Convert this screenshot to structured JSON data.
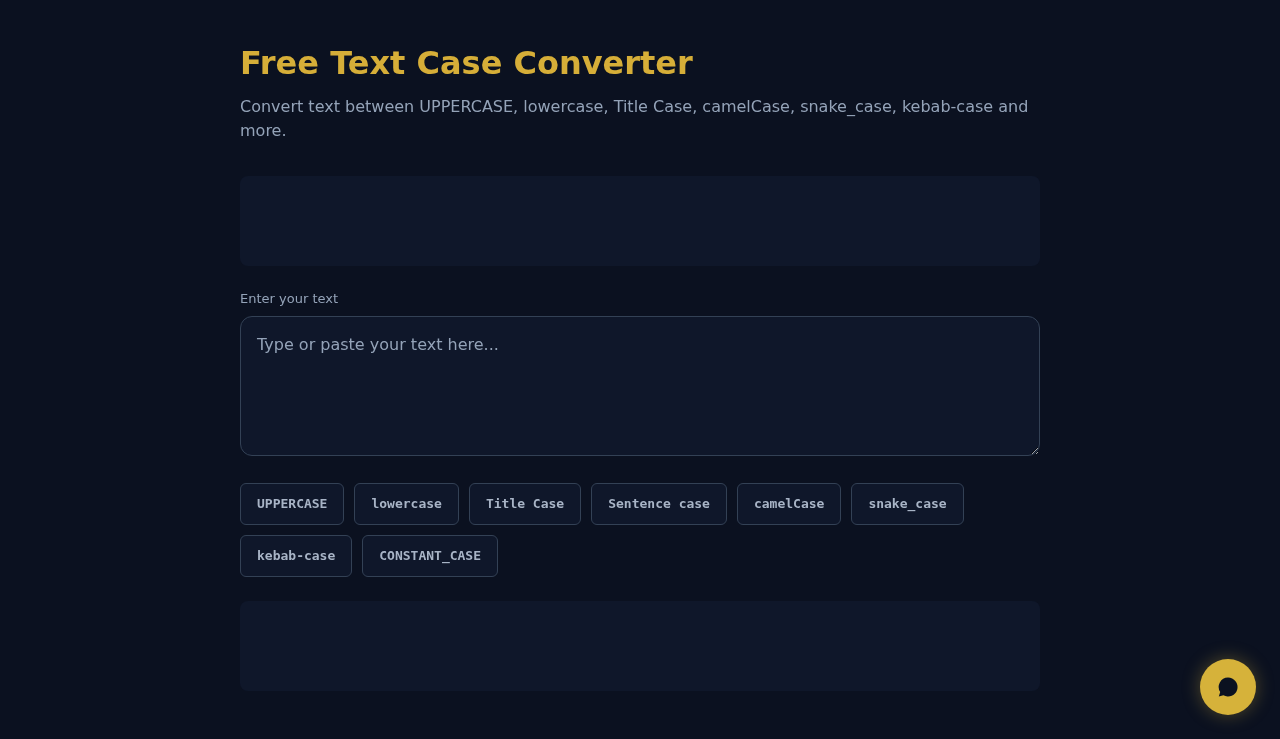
{
  "header": {
    "title": "Free Text Case Converter",
    "subtitle": "Convert text between UPPERCASE, lowercase, Title Case, camelCase, snake_case, kebab-case and more."
  },
  "input": {
    "label": "Enter your text",
    "placeholder": "Type or paste your text here..."
  },
  "case_buttons": [
    "UPPERCASE",
    "lowercase",
    "Title Case",
    "Sentence case",
    "camelCase",
    "snake_case",
    "kebab-case",
    "CONSTANT_CASE"
  ]
}
